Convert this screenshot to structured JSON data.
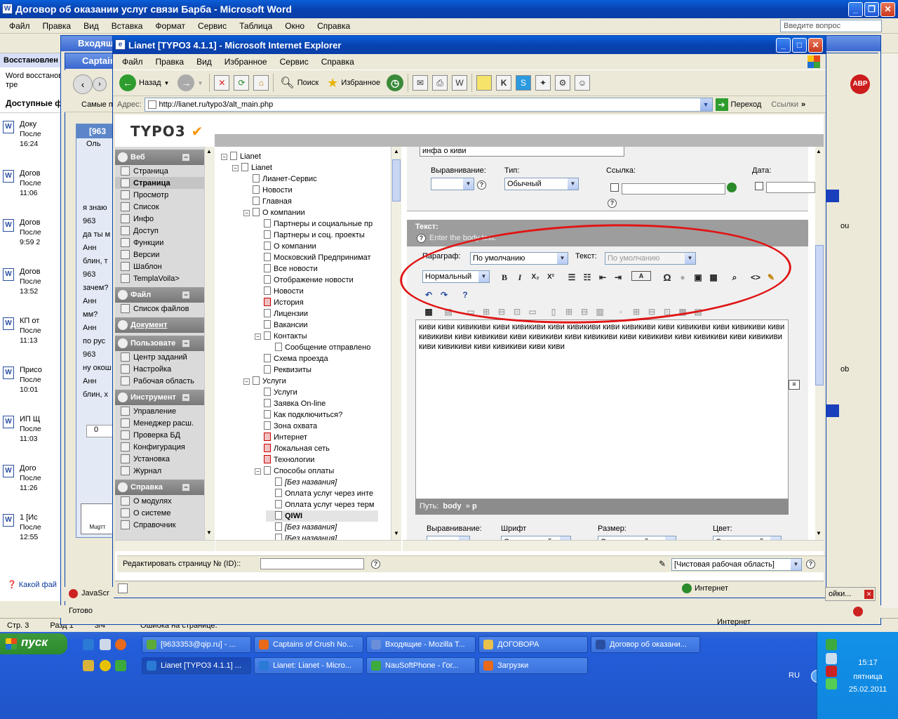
{
  "word": {
    "title": "Договор об оказании услуг связи Барба - Microsoft Word",
    "menu": [
      "Файл",
      "Правка",
      "Вид",
      "Вставка",
      "Формат",
      "Сервис",
      "Таблица",
      "Окно",
      "Справка"
    ],
    "ask_placeholder": "Введите вопрос",
    "recovery_header": "Восстановлен",
    "recovery_note": "Word восстанов Сохраните тре",
    "available_header": "Доступные ф",
    "docs": [
      {
        "name": "Доку",
        "status": "После",
        "time": "16:24"
      },
      {
        "name": "Догов",
        "status": "После",
        "time": "11:06"
      },
      {
        "name": "Догов",
        "status": "После",
        "time": "9:59 2"
      },
      {
        "name": "Догов",
        "status": "После",
        "time": "13:52"
      },
      {
        "name": "КП от",
        "status": "После",
        "time": "11:13"
      },
      {
        "name": "Присо",
        "status": "После",
        "time": "10:01"
      },
      {
        "name": "ИП Щ",
        "status": "После",
        "time": "11:03"
      },
      {
        "name": "Дого",
        "status": "После",
        "time": "11:26"
      },
      {
        "name": "1 [Ис",
        "status": "После",
        "time": "12:55"
      }
    ],
    "which_file": "Какой фай",
    "status": {
      "page": "Стр. 3",
      "section": "Разд 1",
      "pages": "3/4"
    },
    "status_extra": "Ошибка на странице."
  },
  "behind": {
    "thunderbird_title": "Входящи",
    "firefox_title": "Captain",
    "ff_bookmark": "Самые по",
    "qip_title": "[963",
    "qip_tab": "Оль",
    "chat_lines": [
      "я знаю",
      "963",
      "да ты м",
      "Анн",
      "блин, т",
      "963",
      "зачем?",
      "Анн",
      "мм?",
      "Анн",
      "по рус",
      "963",
      "ну окош",
      "Анн",
      "блин, х"
    ],
    "qip_counter": "0",
    "mugg": "Mugтт",
    "right_frag_1": "ou",
    "right_frag_2": "ob",
    "abp": "ABP",
    "js_bar": "JavaScr",
    "ff_settings": "ойки...",
    "internet_zone_back": "Интернет",
    "ready_back": "Готово"
  },
  "ie": {
    "title": "Lianet [TYPO3 4.1.1] - Microsoft Internet Explorer",
    "menu": [
      "Файл",
      "Правка",
      "Вид",
      "Избранное",
      "Сервис",
      "Справка"
    ],
    "back_label": "Назад",
    "search_label": "Поиск",
    "favorites_label": "Избранное",
    "address_label": "Адрес:",
    "url": "http://lianet.ru/typo3/alt_main.php",
    "go_label": "Переход",
    "links_label": "Ссылки",
    "status_text": "",
    "zone": "Интернет"
  },
  "typo3": {
    "logo": "TYPO3",
    "modules": [
      {
        "head": "Веб",
        "items": [
          "Страница",
          "Страница",
          "Просмотр",
          "Список",
          "Инфо",
          "Доступ",
          "Функции",
          "Версии",
          "Шаблон",
          "TemplaVoilа>"
        ]
      },
      {
        "head": "Файл",
        "items": [
          "Список файлов"
        ]
      },
      {
        "head": "Документ",
        "items": []
      },
      {
        "head": "Пользовате",
        "items": [
          "Центр заданий",
          "Настройка",
          "Рабочая область"
        ]
      },
      {
        "head": "Инструмент",
        "items": [
          "Управление",
          "Менеджер расш.",
          "Проверка БД",
          "Конфигурация",
          "Установка",
          "Журнал"
        ]
      },
      {
        "head": "Справка",
        "items": [
          "О модулях",
          "О системе",
          "Справочник"
        ]
      }
    ],
    "tree": [
      {
        "label": "Lianet",
        "indent": 0,
        "toggle": "−"
      },
      {
        "label": "Lianet",
        "indent": 1,
        "toggle": "−"
      },
      {
        "label": "Лианет-Сервис",
        "indent": 2
      },
      {
        "label": "Новости",
        "indent": 2
      },
      {
        "label": "Главная",
        "indent": 2
      },
      {
        "label": "О компании",
        "indent": 2,
        "toggle": "−"
      },
      {
        "label": "Партнеры и социальные пр",
        "indent": 3
      },
      {
        "label": "Партнеры и соц. проекты",
        "indent": 3
      },
      {
        "label": "О компании",
        "indent": 3
      },
      {
        "label": "Московский Предпринимат",
        "indent": 3
      },
      {
        "label": "Все новости",
        "indent": 3
      },
      {
        "label": "Отображение новости",
        "indent": 3
      },
      {
        "label": "Новости",
        "indent": 3
      },
      {
        "label": "История",
        "indent": 3,
        "red": true
      },
      {
        "label": "Лицензии",
        "indent": 3
      },
      {
        "label": "Вакансии",
        "indent": 3
      },
      {
        "label": "Контакты",
        "indent": 3,
        "toggle": "−"
      },
      {
        "label": "Сообщение отправлено",
        "indent": 4
      },
      {
        "label": "Схема проезда",
        "indent": 3
      },
      {
        "label": "Реквизиты",
        "indent": 3
      },
      {
        "label": "Услуги",
        "indent": 2,
        "toggle": "−"
      },
      {
        "label": "Услуги",
        "indent": 3
      },
      {
        "label": "Заявка On-line",
        "indent": 3
      },
      {
        "label": "Как подключиться?",
        "indent": 3
      },
      {
        "label": "Зона охвата",
        "indent": 3
      },
      {
        "label": "Интернет",
        "indent": 3,
        "red": true
      },
      {
        "label": "Локальная сеть",
        "indent": 3,
        "red": true
      },
      {
        "label": "Технологии",
        "indent": 3,
        "red": true
      },
      {
        "label": "Способы оплаты",
        "indent": 3,
        "toggle": "−"
      },
      {
        "label": "[Без названия]",
        "indent": 4,
        "italic": true
      },
      {
        "label": "Оплата услуг через инте",
        "indent": 4
      },
      {
        "label": "Оплата услуг через терм",
        "indent": 4
      },
      {
        "label": "QIWI",
        "indent": 4,
        "selected": true
      },
      {
        "label": "[Без названия]",
        "indent": 4,
        "italic": true
      },
      {
        "label": "[Без названия]",
        "indent": 4,
        "italic": true
      }
    ],
    "form": {
      "header_value": "инфа о киви",
      "align_label": "Выравнивание:",
      "type_label": "Тип:",
      "type_value": "Обычный",
      "link_label": "Ссылка:",
      "date_label": "Дата:",
      "text_section": "Текст:",
      "body_hint": "Enter the body text.",
      "paragraph_label": "Параграф:",
      "paragraph_value": "По умолчанию",
      "text_style_label": "Текст:",
      "text_style_value": "По умолчанию",
      "block_style": "Нормальный",
      "body_text": "киви киви кивикиви киви кивикиви киви кивикиви киви кивикиви киви кивикиви киви кивикиви киви кивикиви киви кивикиви киви кивикиви киви кивикиви киви кивикиви киви кивикиви киви кивикиви киви кивикиви киви кивикиви киви киви",
      "path_label": "Путь:",
      "path_body": "body",
      "path_p": "p",
      "align2_label": "Выравнивание:",
      "font_label": "Шрифт",
      "font_value": "Стандартный",
      "size_label": "Размер:",
      "size_value": "Стандартный",
      "color_label": "Цвет:",
      "color_value": "Стандартный"
    },
    "edit_page_label": "Редактировать страницу № (ID)::",
    "workspace_value": "[Чистовая рабочая область]"
  },
  "taskbar": {
    "start": "пуск",
    "row1": [
      "[9633353@qip.ru] - ...",
      "Captains of Crush No...",
      "Входящие - Mozilla T...",
      "ДОГОВОРА",
      "Договор об оказани..."
    ],
    "row2": [
      "Lianet [TYPO3 4.1.1] ...",
      "Lianet: Lianet - Micro...",
      "NauSoftPhone - Гог...",
      "Загрузки"
    ],
    "lang": "RU",
    "time": "15:17",
    "day": "пятница",
    "date": "25.02.2011"
  }
}
